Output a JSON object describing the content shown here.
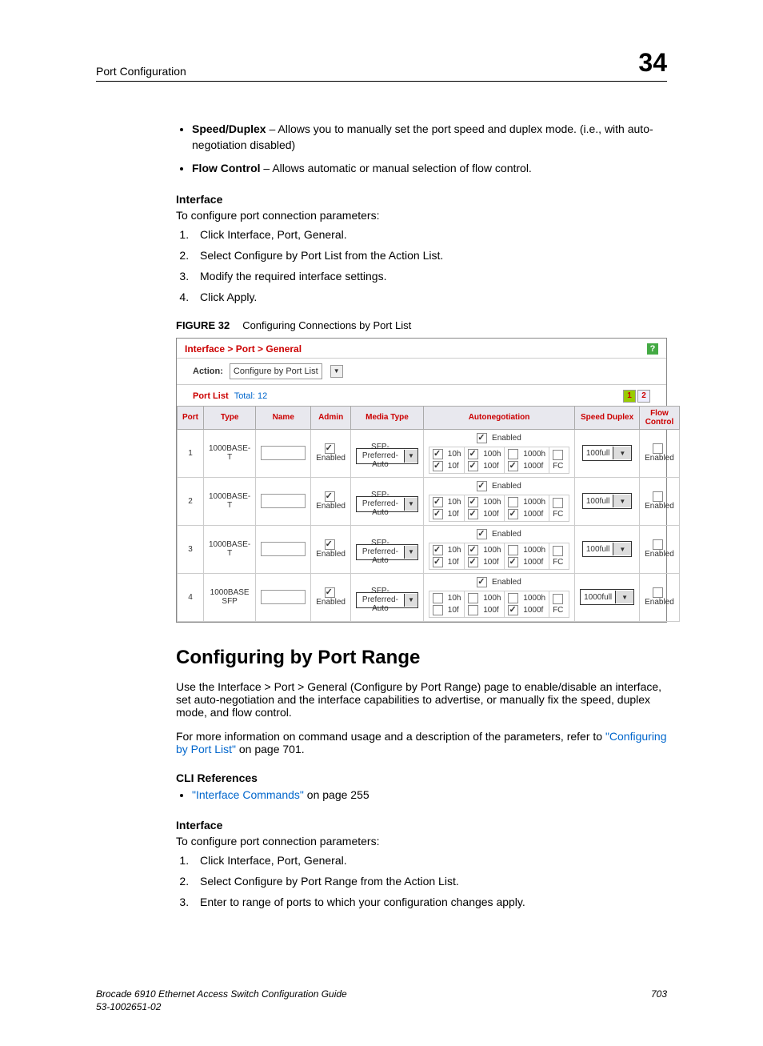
{
  "header": {
    "left": "Port Configuration",
    "right": "34"
  },
  "topBullets": [
    {
      "bold": "Speed/Duplex",
      "rest": " – Allows you to manually set the port speed and duplex mode. (i.e., with auto-negotiation disabled)"
    },
    {
      "bold": "Flow Control",
      "rest": " – Allows automatic or manual selection of flow control."
    }
  ],
  "interface1": {
    "heading": "Interface",
    "intro": "To configure port connection parameters:",
    "steps": [
      "Click Interface, Port, General.",
      "Select Configure by Port List from the Action List.",
      "Modify the required interface settings.",
      "Click Apply."
    ]
  },
  "figure": {
    "label": "FIGURE 32",
    "title": "Configuring Connections by Port List"
  },
  "screenshot": {
    "breadcrumb": "Interface > Port > General",
    "actionLabel": "Action:",
    "actionSelected": "Configure by Port List",
    "portListLabel": "Port List",
    "portListTotal": "Total: 12",
    "pages": [
      "1",
      "2"
    ],
    "columns": [
      "Port",
      "Type",
      "Name",
      "Admin",
      "Media Type",
      "Autonegotiation",
      "Speed Duplex",
      "Flow Control"
    ],
    "rows": [
      {
        "port": "1",
        "type": "1000BASE-T",
        "admin": "Enabled",
        "media": "SFP-Preferred-Auto",
        "autonegEnabled": true,
        "caps": {
          "c10h": true,
          "c10f": true,
          "c100h": true,
          "c100f": true,
          "c1000h": false,
          "c1000f": true,
          "fc": false
        },
        "speed": "100full",
        "flow": "Enabled",
        "flowCb": false
      },
      {
        "port": "2",
        "type": "1000BASE-T",
        "admin": "Enabled",
        "media": "SFP-Preferred-Auto",
        "autonegEnabled": true,
        "caps": {
          "c10h": true,
          "c10f": true,
          "c100h": true,
          "c100f": true,
          "c1000h": false,
          "c1000f": true,
          "fc": false
        },
        "speed": "100full",
        "flow": "Enabled",
        "flowCb": false
      },
      {
        "port": "3",
        "type": "1000BASE-T",
        "admin": "Enabled",
        "media": "SFP-Preferred-Auto",
        "autonegEnabled": true,
        "caps": {
          "c10h": true,
          "c10f": true,
          "c100h": true,
          "c100f": true,
          "c1000h": false,
          "c1000f": true,
          "fc": false
        },
        "speed": "100full",
        "flow": "Enabled",
        "flowCb": false
      },
      {
        "port": "4",
        "type": "1000BASE SFP",
        "admin": "Enabled",
        "media": "SFP-Preferred-Auto",
        "autonegEnabled": true,
        "caps": {
          "c10h": false,
          "c10f": false,
          "c100h": false,
          "c100f": false,
          "c1000h": false,
          "c1000f": true,
          "fc": false
        },
        "speed": "1000full",
        "flow": "Enabled",
        "flowCb": false
      }
    ],
    "capLabels": {
      "c10h": "10h",
      "c10f": "10f",
      "c100h": "100h",
      "c100f": "100f",
      "c1000h": "1000h",
      "c1000f": "1000f",
      "fc": "FC",
      "enabled": "Enabled"
    }
  },
  "section2": {
    "heading": "Configuring by Port Range",
    "p1": "Use the Interface > Port > General (Configure by Port Range) page to enable/disable an interface, set auto-negotiation and the interface capabilities to advertise, or manually fix the speed, duplex mode, and flow control.",
    "p2a": "For more information on command usage and a description of the parameters, refer to ",
    "p2link": "\"Configuring by Port List\"",
    "p2b": " on page 701.",
    "cliHeading": "CLI References",
    "cliLink": "\"Interface Commands\"",
    "cliTail": " on page 255",
    "ifaceHeading": "Interface",
    "ifaceIntro": "To configure port connection parameters:",
    "steps": [
      "Click Interface, Port, General.",
      "Select Configure by Port Range from the Action List.",
      "Enter to range of ports to which your configuration changes apply."
    ]
  },
  "footer": {
    "line1": "Brocade 6910 Ethernet Access Switch Configuration Guide",
    "line2": "53-1002651-02",
    "page": "703"
  }
}
